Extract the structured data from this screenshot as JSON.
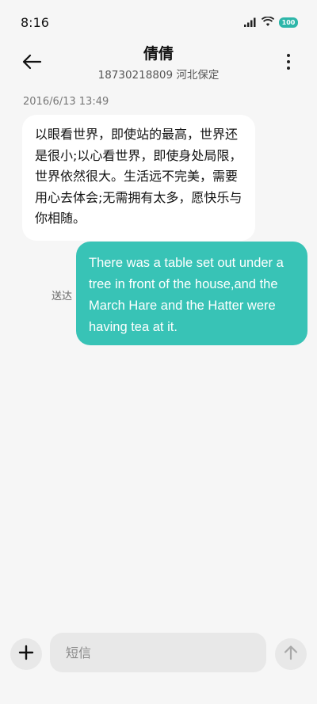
{
  "status_bar": {
    "time": "8:16",
    "battery_level": "100",
    "icons": [
      "signal-icon",
      "wifi-icon",
      "battery-icon"
    ]
  },
  "header": {
    "contact_name": "倩倩",
    "contact_subtitle": "18730218809 河北保定",
    "icons": [
      "back-arrow-icon",
      "more-vertical-icon"
    ]
  },
  "conversation": {
    "timestamp": "2016/6/13 13:49",
    "incoming_message": "以眼看世界，即使站的最高，世界还是很小;以心看世界，即使身处局限，世界依然很大。生活远不完美，需要用心去体会;无需拥有太多，愿快乐与你相随。",
    "outgoing_message": "There was a table set out under a tree in front of the house,and the March Hare and the Hatter were having tea at it.",
    "delivery_status": "送达"
  },
  "composer": {
    "placeholder": "短信",
    "value": "",
    "icons": [
      "add-icon",
      "send-arrow-icon"
    ]
  },
  "colors": {
    "background": "#f6f6f6",
    "outgoing_bubble": "#38c3b6",
    "incoming_bubble": "#ffffff",
    "input_background": "#e8e8e8"
  }
}
